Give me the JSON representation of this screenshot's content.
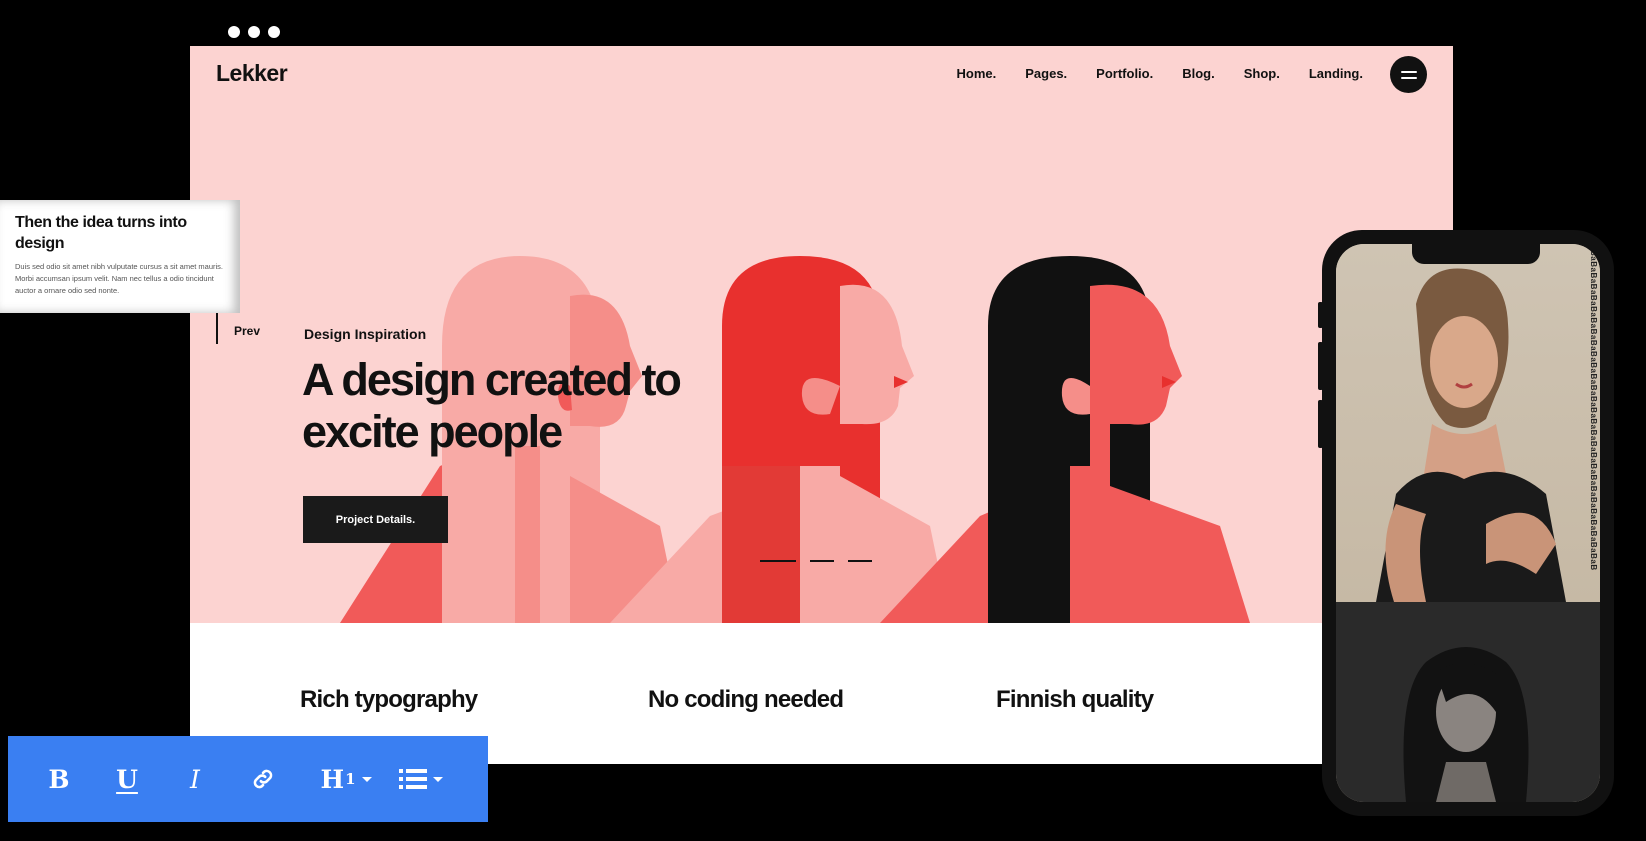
{
  "window": {
    "controls": [
      "dot",
      "dot",
      "dot"
    ]
  },
  "site": {
    "logo": "Lekker",
    "nav": [
      "Home.",
      "Pages.",
      "Portfolio.",
      "Blog.",
      "Shop.",
      "Landing."
    ],
    "menu_icon": "hamburger-icon"
  },
  "hero": {
    "prev_label": "Prev",
    "eyebrow": "Design Inspiration",
    "headline": "A design created to excite people",
    "cta_label": "Project Details.",
    "slider_count": 3,
    "colors": {
      "background": "#fcd3d1",
      "red": "#e8302e",
      "coral": "#f15a59",
      "pink": "#f89894",
      "black": "#111111"
    }
  },
  "features": [
    {
      "title": "Rich typography"
    },
    {
      "title": "No coding needed"
    },
    {
      "title": "Finnish quality"
    }
  ],
  "card": {
    "title": "Then the idea turns into design",
    "body": "Duis sed odio sit amet nibh vulputate cursus a sit amet mauris. Morbi accumsan ipsum velit. Nam nec tellus a odio tincidunt auctor a ornare odio sed nonte."
  },
  "toolbar": {
    "bold": "B",
    "underline": "U",
    "italic": "I",
    "link_icon": "link-icon",
    "heading": "H",
    "heading_level": "1",
    "list_icon": "list-icon",
    "color": "#3a7ff2"
  },
  "phone": {
    "vertical_text": "BaBaBaBaBaBaBaBaBaBaBaBaBaBaBaBaBaBaBaBaBaBaBaBaBaBaBaBaBaBaBaBa"
  }
}
